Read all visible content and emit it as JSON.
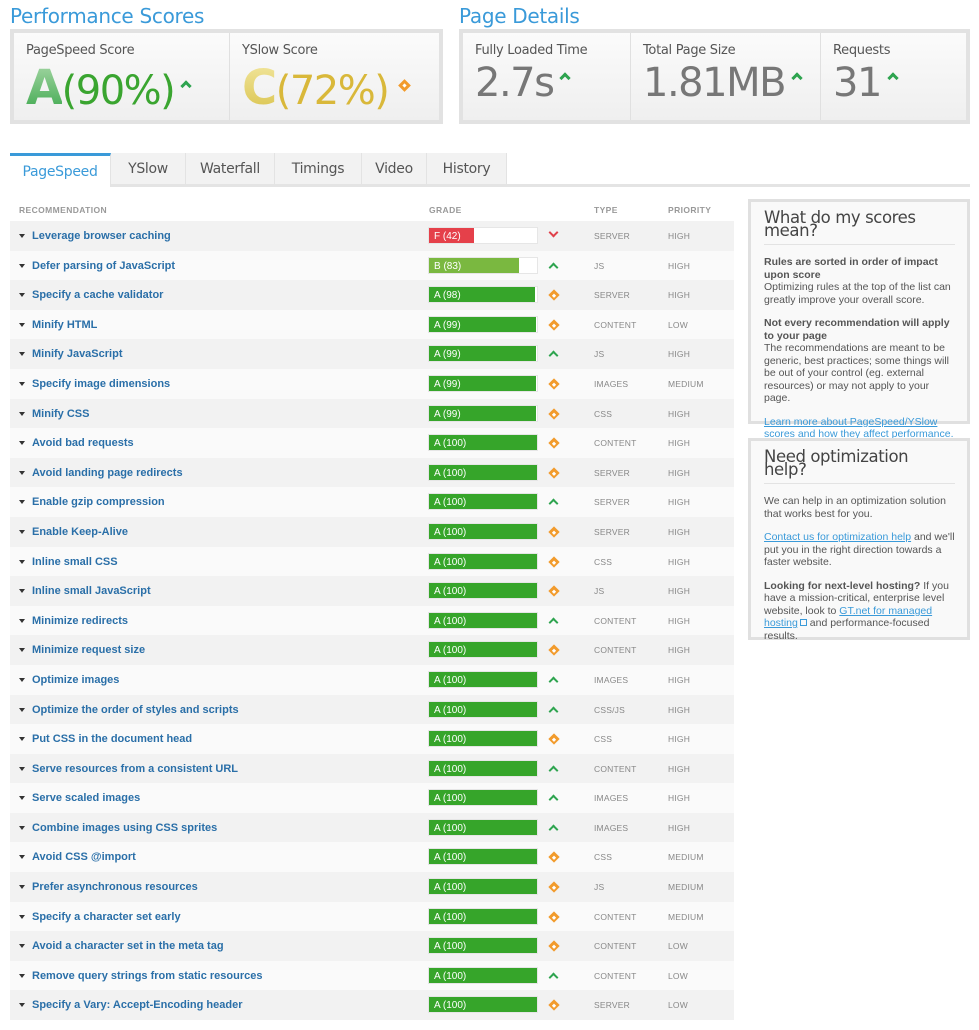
{
  "performance": {
    "title": "Performance Scores",
    "pagespeed": {
      "label": "PageSpeed Score",
      "grade": "A",
      "percent": "(90%)",
      "trend": "up"
    },
    "yslow": {
      "label": "YSlow Score",
      "grade": "C",
      "percent": "(72%)",
      "trend": "neutral"
    }
  },
  "details": {
    "title": "Page Details",
    "loaded": {
      "label": "Fully Loaded Time",
      "value": "2.7s",
      "trend": "up"
    },
    "size": {
      "label": "Total Page Size",
      "value": "1.81MB",
      "trend": "up"
    },
    "requests": {
      "label": "Requests",
      "value": "31",
      "trend": "up"
    }
  },
  "tabs": [
    {
      "label": "PageSpeed",
      "active": true
    },
    {
      "label": "YSlow"
    },
    {
      "label": "Waterfall"
    },
    {
      "label": "Timings"
    },
    {
      "label": "Video"
    },
    {
      "label": "History"
    }
  ],
  "table": {
    "headers": {
      "recommendation": "RECOMMENDATION",
      "grade": "GRADE",
      "type": "TYPE",
      "priority": "PRIORITY"
    },
    "colors": {
      "A": "#36a52a",
      "B": "#7ab840",
      "F": "#e5404a"
    },
    "rows": [
      {
        "name": "Leverage browser caching",
        "letter": "F",
        "score": 42,
        "trend": "down",
        "type": "SERVER",
        "priority": "HIGH"
      },
      {
        "name": "Defer parsing of JavaScript",
        "letter": "B",
        "score": 83,
        "trend": "up",
        "type": "JS",
        "priority": "HIGH"
      },
      {
        "name": "Specify a cache validator",
        "letter": "A",
        "score": 98,
        "trend": "neutral",
        "type": "SERVER",
        "priority": "HIGH"
      },
      {
        "name": "Minify HTML",
        "letter": "A",
        "score": 99,
        "trend": "neutral",
        "type": "CONTENT",
        "priority": "LOW"
      },
      {
        "name": "Minify JavaScript",
        "letter": "A",
        "score": 99,
        "trend": "up",
        "type": "JS",
        "priority": "HIGH"
      },
      {
        "name": "Specify image dimensions",
        "letter": "A",
        "score": 99,
        "trend": "neutral",
        "type": "IMAGES",
        "priority": "MEDIUM"
      },
      {
        "name": "Minify CSS",
        "letter": "A",
        "score": 99,
        "trend": "neutral",
        "type": "CSS",
        "priority": "HIGH"
      },
      {
        "name": "Avoid bad requests",
        "letter": "A",
        "score": 100,
        "trend": "neutral",
        "type": "CONTENT",
        "priority": "HIGH"
      },
      {
        "name": "Avoid landing page redirects",
        "letter": "A",
        "score": 100,
        "trend": "neutral",
        "type": "SERVER",
        "priority": "HIGH"
      },
      {
        "name": "Enable gzip compression",
        "letter": "A",
        "score": 100,
        "trend": "up",
        "type": "SERVER",
        "priority": "HIGH"
      },
      {
        "name": "Enable Keep-Alive",
        "letter": "A",
        "score": 100,
        "trend": "neutral",
        "type": "SERVER",
        "priority": "HIGH"
      },
      {
        "name": "Inline small CSS",
        "letter": "A",
        "score": 100,
        "trend": "neutral",
        "type": "CSS",
        "priority": "HIGH"
      },
      {
        "name": "Inline small JavaScript",
        "letter": "A",
        "score": 100,
        "trend": "neutral",
        "type": "JS",
        "priority": "HIGH"
      },
      {
        "name": "Minimize redirects",
        "letter": "A",
        "score": 100,
        "trend": "up",
        "type": "CONTENT",
        "priority": "HIGH"
      },
      {
        "name": "Minimize request size",
        "letter": "A",
        "score": 100,
        "trend": "neutral",
        "type": "CONTENT",
        "priority": "HIGH"
      },
      {
        "name": "Optimize images",
        "letter": "A",
        "score": 100,
        "trend": "up",
        "type": "IMAGES",
        "priority": "HIGH"
      },
      {
        "name": "Optimize the order of styles and scripts",
        "letter": "A",
        "score": 100,
        "trend": "up",
        "type": "CSS/JS",
        "priority": "HIGH"
      },
      {
        "name": "Put CSS in the document head",
        "letter": "A",
        "score": 100,
        "trend": "neutral",
        "type": "CSS",
        "priority": "HIGH"
      },
      {
        "name": "Serve resources from a consistent URL",
        "letter": "A",
        "score": 100,
        "trend": "up",
        "type": "CONTENT",
        "priority": "HIGH"
      },
      {
        "name": "Serve scaled images",
        "letter": "A",
        "score": 100,
        "trend": "up",
        "type": "IMAGES",
        "priority": "HIGH"
      },
      {
        "name": "Combine images using CSS sprites",
        "letter": "A",
        "score": 100,
        "trend": "up",
        "type": "IMAGES",
        "priority": "HIGH"
      },
      {
        "name": "Avoid CSS @import",
        "letter": "A",
        "score": 100,
        "trend": "neutral",
        "type": "CSS",
        "priority": "MEDIUM"
      },
      {
        "name": "Prefer asynchronous resources",
        "letter": "A",
        "score": 100,
        "trend": "neutral",
        "type": "JS",
        "priority": "MEDIUM"
      },
      {
        "name": "Specify a character set early",
        "letter": "A",
        "score": 100,
        "trend": "neutral",
        "type": "CONTENT",
        "priority": "MEDIUM"
      },
      {
        "name": "Avoid a character set in the meta tag",
        "letter": "A",
        "score": 100,
        "trend": "neutral",
        "type": "CONTENT",
        "priority": "LOW"
      },
      {
        "name": "Remove query strings from static resources",
        "letter": "A",
        "score": 100,
        "trend": "up",
        "type": "CONTENT",
        "priority": "LOW"
      },
      {
        "name": "Specify a Vary: Accept-Encoding header",
        "letter": "A",
        "score": 100,
        "trend": "neutral",
        "type": "SERVER",
        "priority": "LOW"
      }
    ]
  },
  "scores_panel": {
    "title": "What do my scores mean?",
    "p1_bold": "Rules are sorted in order of impact upon score",
    "p1_text": "Optimizing rules at the top of the list can greatly improve your overall score.",
    "p2_bold": "Not every recommendation will apply to your page",
    "p2_text": "The recommendations are meant to be generic, best practices; some things will be out of your control (eg. external resources) or may not apply to your page.",
    "link": "Learn more about PageSpeed/YSlow scores and how they affect performance."
  },
  "help_panel": {
    "title": "Need optimization help?",
    "p1": "We can help in an optimization solution that works best for you.",
    "contact_link": "Contact us for optimization help",
    "p2_rest": " and we'll put you in the right direction towards a faster website.",
    "p3_bold": "Looking for next-level hosting?",
    "p3_text": " If you have a mission-critical, enterprise level website, look to ",
    "gt_link": "GT.net for managed hosting",
    "p3_end": " and performance-focused results."
  }
}
